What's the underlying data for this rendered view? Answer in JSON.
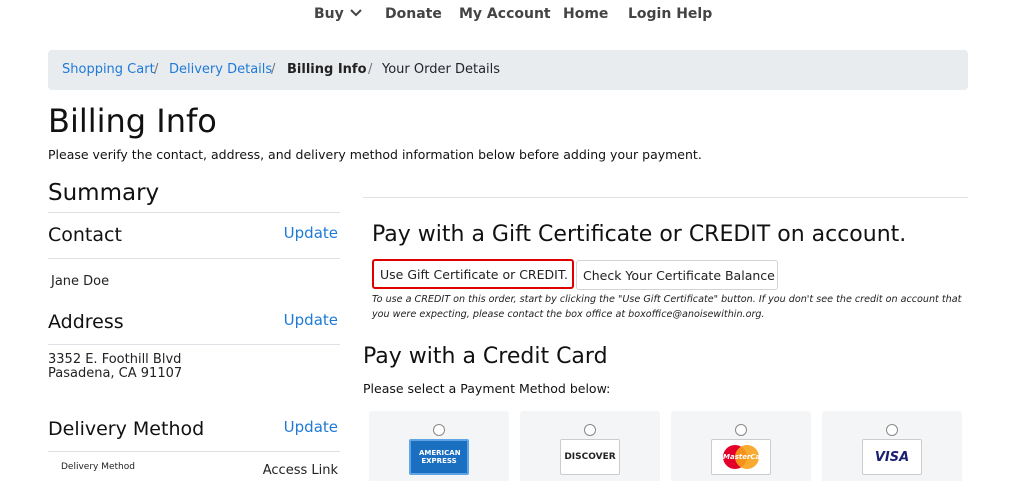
{
  "nav": {
    "buy": "Buy",
    "donate": "Donate",
    "my_account": "My Account",
    "home": "Home",
    "login_help": "Login Help"
  },
  "breadcrumb": {
    "items": [
      "Shopping Cart",
      "Delivery Details",
      "Billing Info",
      "Your Order Details"
    ],
    "separator": "/"
  },
  "page": {
    "title": "Billing Info",
    "intro": "Please verify the contact, address, and delivery method information below before adding your payment."
  },
  "summary": {
    "title": "Summary",
    "update_label": "Update",
    "contact": {
      "title": "Contact",
      "name": "Jane Doe"
    },
    "address": {
      "title": "Address",
      "line1": "3352 E. Foothill Blvd",
      "line2": "Pasadena, CA 91107"
    },
    "delivery": {
      "title": "Delivery Method",
      "label": "Delivery Method",
      "value": "Access Link"
    }
  },
  "gift": {
    "heading": "Pay with a Gift Certificate or CREDIT on account.",
    "use_button": "Use Gift Certificate or CREDIT.",
    "balance_button": "Check Your Certificate Balance",
    "note": "To use a CREDIT on this order, start by clicking the \"Use Gift Certificate\" button. If you don't see the credit on account that you were expecting, please contact the box office at boxoffice@anoisewithin.org."
  },
  "credit_card": {
    "heading": "Pay with a Credit Card",
    "instruction": "Please select a Payment Method below:",
    "methods": [
      {
        "name": "American Express",
        "logo_text": "AMERICAN EXPRESS"
      },
      {
        "name": "Discover",
        "logo_text": "DISCOVER"
      },
      {
        "name": "MasterCard",
        "logo_text": "MasterCard"
      },
      {
        "name": "Visa",
        "logo_text": "VISA"
      }
    ]
  },
  "colors": {
    "link": "#1d7ad8",
    "highlight_border": "#e00000",
    "breadcrumb_bg": "#e9ecef"
  },
  "icons": {
    "buy_dropdown": "chevron-down-icon"
  }
}
